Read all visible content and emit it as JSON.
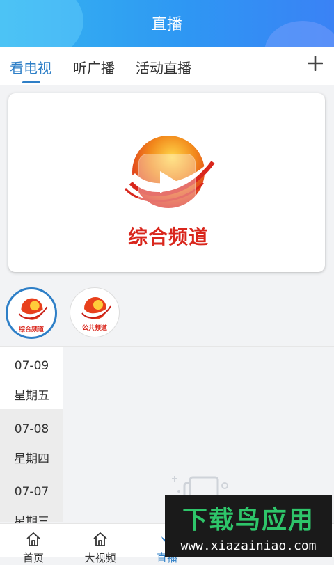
{
  "header": {
    "title": "直播"
  },
  "tabs": [
    {
      "label": "看电视",
      "active": true
    },
    {
      "label": "听广播",
      "active": false
    },
    {
      "label": "活动直播",
      "active": false
    }
  ],
  "add_icon": "plus-icon",
  "player": {
    "channel_title": "综合频道"
  },
  "channels": [
    {
      "label": "综合频道",
      "active": true
    },
    {
      "label": "公共频道",
      "active": false
    }
  ],
  "dates": [
    {
      "date": "07-09",
      "weekday": "星期五",
      "active": true
    },
    {
      "date": "07-08",
      "weekday": "星期四",
      "active": false
    },
    {
      "date": "07-07",
      "weekday": "星期三",
      "active": false
    }
  ],
  "bottom_nav": [
    {
      "label": "首页",
      "icon": "home-icon"
    },
    {
      "label": "大视频",
      "icon": "home-icon"
    },
    {
      "label": "直播",
      "icon": "live-icon",
      "active": true
    },
    {
      "label": "",
      "icon": ""
    },
    {
      "label": "",
      "icon": ""
    }
  ],
  "watermark": {
    "title": "下载鸟应用",
    "url": "www.xiazainiao.com"
  },
  "colors": {
    "accent": "#2e7fc7",
    "logo_red": "#d9261c",
    "header_start": "#35b6f0",
    "header_end": "#3a82f5"
  }
}
